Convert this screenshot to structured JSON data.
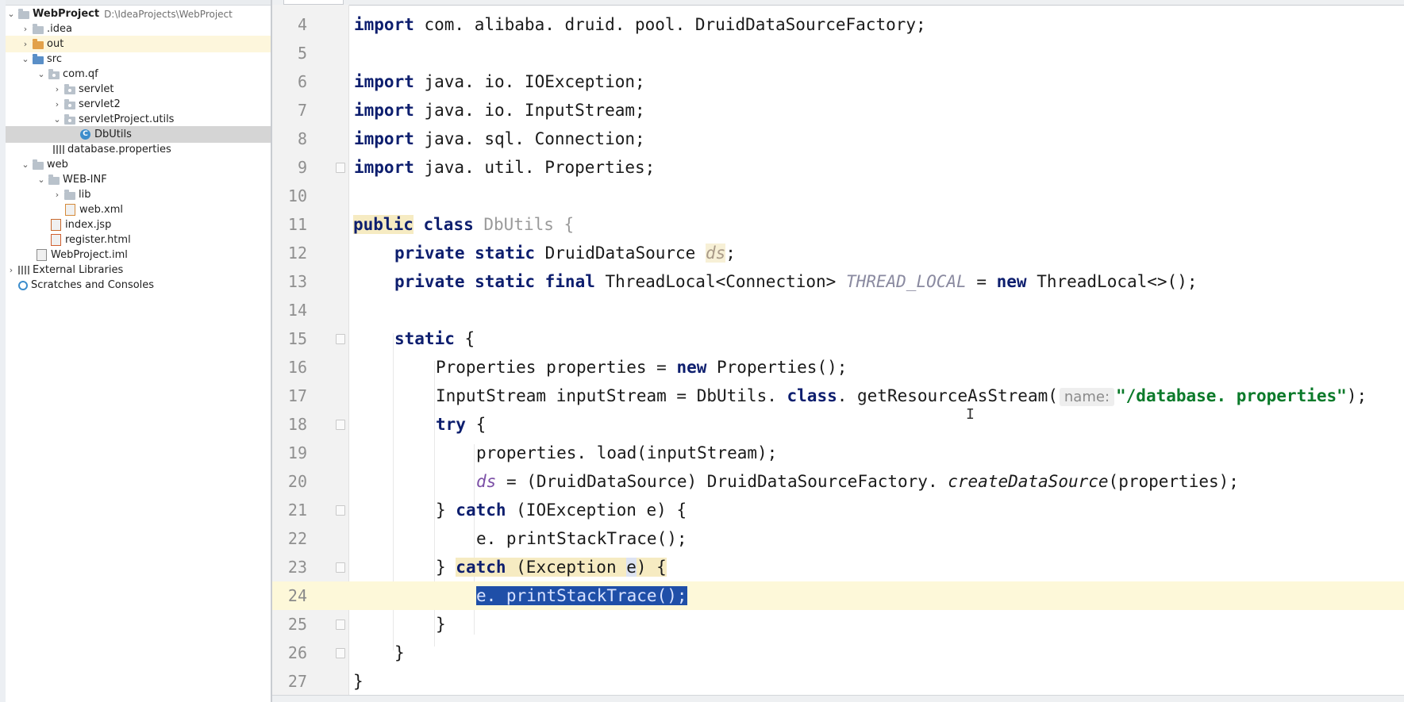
{
  "project_tree": {
    "header_stub": "Project",
    "items": [
      {
        "label": "WebProject",
        "path": "D:\\IdeaProjects\\WebProject"
      },
      {
        "label": ".idea"
      },
      {
        "label": "out"
      },
      {
        "label": "src"
      },
      {
        "label": "com.qf"
      },
      {
        "label": "servlet"
      },
      {
        "label": "servlet2"
      },
      {
        "label": "servletProject.utils"
      },
      {
        "label": "DbUtils"
      },
      {
        "label": "database.properties"
      },
      {
        "label": "web"
      },
      {
        "label": "WEB-INF"
      },
      {
        "label": "lib"
      },
      {
        "label": "web.xml"
      },
      {
        "label": "index.jsp"
      },
      {
        "label": "register.html"
      },
      {
        "label": "WebProject.iml"
      },
      {
        "label": "External Libraries"
      },
      {
        "label": "Scratches and Consoles"
      }
    ]
  },
  "editor": {
    "line_numbers": [
      "4",
      "5",
      "6",
      "7",
      "8",
      "9",
      "10",
      "11",
      "12",
      "13",
      "14",
      "15",
      "16",
      "17",
      "18",
      "19",
      "20",
      "21",
      "22",
      "23",
      "24",
      "25",
      "26",
      "27"
    ],
    "code": {
      "l4_kw": "import",
      "l4_rest": " com. alibaba. druid. pool. DruidDataSourceFactory;",
      "l6_kw": "import",
      "l6_rest": " java. io. IOException;",
      "l7_kw": "import",
      "l7_rest": " java. io. InputStream;",
      "l8_kw": "import",
      "l8_rest": " java. sql. Connection;",
      "l9_kw": "import",
      "l9_rest": " java. util. Properties;",
      "l11_public": "public",
      "l11_class": "class",
      "l11_name": "DbUtils",
      "l11_brace": " {",
      "l12_kw": "private static",
      "l12_type": " DruidDataSource ",
      "l12_field": "ds",
      "l12_end": ";",
      "l13_kw": "private static final",
      "l13_type": " ThreadLocal<Connection> ",
      "l13_const": "THREAD_LOCAL",
      "l13_eq": " = ",
      "l13_new": "new",
      "l13_end": " ThreadLocal<>();",
      "l15_kw": "static",
      "l15_brace": " {",
      "l16_a": "Properties properties = ",
      "l16_new": "new",
      "l16_b": " Properties();",
      "l17_a": "InputStream inputStream = DbUtils. ",
      "l17_class": "class",
      "l17_b": ". getResourceAsStream(",
      "l17_hint": "name:",
      "l17_str": "\"/database. properties\"",
      "l17_end": ");",
      "l18_kw": "try",
      "l18_brace": " {",
      "l19": "properties. load(inputStream);",
      "l20_field": "ds",
      "l20_a": " = (DruidDataSource) DruidDataSourceFactory. ",
      "l20_meth": "createDataSource",
      "l20_b": "(properties);",
      "l21_a": "} ",
      "l21_kw": "catch",
      "l21_b": " (IOException e) {",
      "l22": "e. printStackTrace();",
      "l23_a": "} ",
      "l23_kw": "catch",
      "l23_b": " (Exception ",
      "l23_e": "e",
      "l23_c": ") {",
      "l24_sel": "e. printStackTrace();",
      "l25": "}",
      "l26": "}",
      "l27": "}"
    }
  },
  "colors": {
    "keyword": "#0d1e6e",
    "string": "#0b7a2a",
    "field": "#7b4fa6",
    "selection": "#1f4fa8",
    "current_line": "#fdf8d9"
  }
}
